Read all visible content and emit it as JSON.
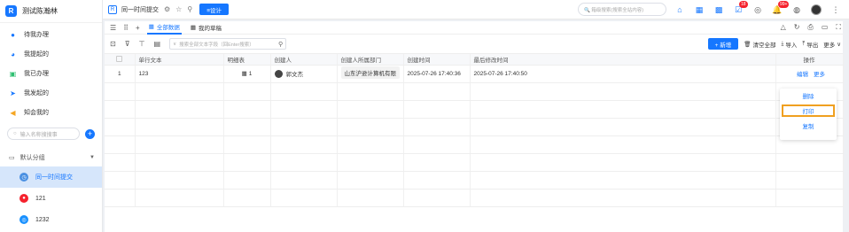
{
  "sidebar": {
    "org_name": "测试陈瀚林",
    "logo_letter": "R",
    "menu": [
      {
        "label": "待我办理",
        "icon": "person-icon",
        "color": "#1677ff"
      },
      {
        "label": "我提起的",
        "icon": "person-share-icon",
        "color": "#1677ff"
      },
      {
        "label": "我已办理",
        "icon": "doc-check-icon",
        "color": "#2fbf71"
      },
      {
        "label": "我发起的",
        "icon": "send-icon",
        "color": "#1677ff"
      },
      {
        "label": "知会我的",
        "icon": "bell-icon",
        "color": "#f5a623"
      }
    ],
    "search_placeholder": "输入名称搜搜事",
    "group_label": "默认分组",
    "forms": [
      {
        "label": "同一时间提交",
        "color": "#4a90e2",
        "active": true
      },
      {
        "label": "121",
        "color": "#f5222d",
        "active": false
      },
      {
        "label": "1232",
        "color": "#1890ff",
        "active": false
      }
    ]
  },
  "topbar": {
    "form_title": "同一时间提交",
    "design_label": "≡设计",
    "search_placeholder": "🔍 箱级搜索(搜索全站内容)",
    "badges": {
      "notify": "18",
      "bell": "99+"
    }
  },
  "tabs": [
    {
      "label": "全部数据",
      "active": true
    },
    {
      "label": "我的草稿",
      "active": false
    }
  ],
  "toolbar": {
    "search_placeholder": "搜索全部文本字段（回Enter搜索）",
    "new_label": "+ 新增",
    "clear_label": "清空全部",
    "import_label": "导入",
    "export_label": "导出",
    "more_label": "更多"
  },
  "table": {
    "headers": [
      "",
      "单行文本",
      "明细表",
      "创建人",
      "创建人所属部门",
      "创建时间",
      "最后修改时间",
      "操作"
    ],
    "rows": [
      {
        "index": "1",
        "text": "123",
        "detail_count": "1",
        "creator": "郭文杰",
        "dept": "山东沪逊计算机有限",
        "created": "2025-07-26 17:40:36",
        "modified": "2025-07-26 17:40:50",
        "edit": "编辑",
        "more": "更多"
      }
    ]
  },
  "dropdown": {
    "items": [
      "删除",
      "打印",
      "复制"
    ]
  }
}
